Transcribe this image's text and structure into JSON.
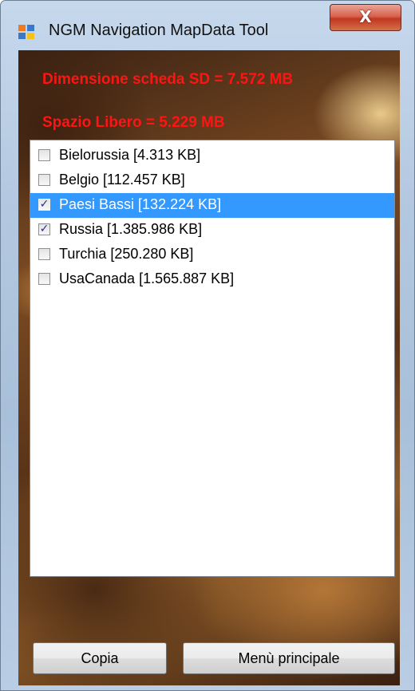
{
  "window": {
    "title": "NGM Navigation MapData Tool",
    "close_label": "X"
  },
  "info": {
    "sd_size": "Dimensione scheda SD = 7.572 MB",
    "free_space": "Spazio Libero = 5.229 MB"
  },
  "list": {
    "items": [
      {
        "label": "Bielorussia  [4.313 KB]",
        "checked": false,
        "selected": false
      },
      {
        "label": "Belgio  [112.457 KB]",
        "checked": false,
        "selected": false
      },
      {
        "label": "Paesi Bassi  [132.224 KB]",
        "checked": true,
        "selected": true
      },
      {
        "label": "Russia  [1.385.986 KB]",
        "checked": true,
        "selected": false
      },
      {
        "label": "Turchia  [250.280 KB]",
        "checked": false,
        "selected": false
      },
      {
        "label": "UsaCanada  [1.565.887 KB]",
        "checked": false,
        "selected": false
      }
    ]
  },
  "buttons": {
    "copy_label": "Copia",
    "main_menu_label": "Menù principale"
  },
  "colors": {
    "info_text": "#ff1414",
    "selection": "#3399ff"
  }
}
